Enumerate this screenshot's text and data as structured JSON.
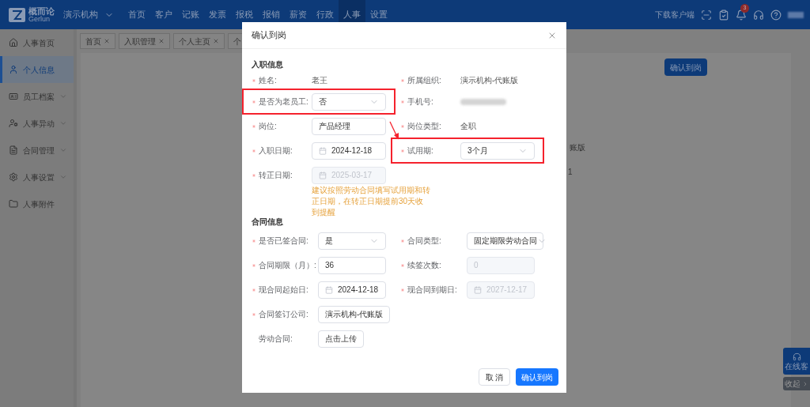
{
  "nav": {
    "logo_name": "概而论",
    "logo_sub": "Gerlun",
    "org": "演示机构",
    "menu": [
      {
        "label": "首页",
        "selected": false
      },
      {
        "label": "客户",
        "selected": false
      },
      {
        "label": "记账",
        "selected": false
      },
      {
        "label": "发票",
        "selected": false
      },
      {
        "label": "报税",
        "selected": false
      },
      {
        "label": "报销",
        "selected": false
      },
      {
        "label": "薪资",
        "selected": false
      },
      {
        "label": "行政",
        "selected": false
      },
      {
        "label": "人事",
        "selected": true
      },
      {
        "label": "设置",
        "selected": false
      }
    ],
    "download": "下载客户端",
    "badge": "3"
  },
  "sidebar": {
    "items": [
      {
        "label": "人事首页",
        "selected": false,
        "expandable": false
      },
      {
        "label": "个人信息",
        "selected": true,
        "expandable": false
      },
      {
        "label": "员工档案",
        "selected": false,
        "expandable": true
      },
      {
        "label": "人事异动",
        "selected": false,
        "expandable": true
      },
      {
        "label": "合同管理",
        "selected": false,
        "expandable": true
      },
      {
        "label": "人事设置",
        "selected": false,
        "expandable": true
      },
      {
        "label": "人事附件",
        "selected": false,
        "expandable": false
      }
    ]
  },
  "tabs": [
    {
      "label": "首页",
      "closable": true
    },
    {
      "label": "入职管理",
      "closable": true
    },
    {
      "label": "个人主页",
      "closable": true
    },
    {
      "label": "个",
      "closable": false
    }
  ],
  "content": {
    "confirm_button": "确认到岗",
    "fragments": [
      "账版",
      "1"
    ]
  },
  "floating": {
    "service": "在线客",
    "collapse": "收起"
  },
  "modal": {
    "title": "确认到岗",
    "sections": [
      {
        "title": "入职信息",
        "rows": [
          {
            "fields": [
              {
                "label": "姓名:",
                "required": true,
                "kind": "text",
                "value": "老王",
                "highlighted": false
              },
              {
                "label": "所属组织:",
                "required": true,
                "kind": "text",
                "value": "演示机构-代账版",
                "highlighted": false
              }
            ]
          },
          {
            "fields": [
              {
                "label": "是否为老员工:",
                "required": true,
                "kind": "select",
                "value": "否",
                "highlighted": true
              },
              {
                "label": "手机号:",
                "required": true,
                "kind": "blurred",
                "highlighted": false
              }
            ]
          },
          {
            "fields": [
              {
                "label": "岗位:",
                "required": true,
                "kind": "input",
                "value": "产品经理",
                "disabled": false,
                "highlighted": false
              },
              {
                "label": "岗位类型:",
                "required": true,
                "kind": "text",
                "value": "全职",
                "highlighted": false
              }
            ]
          },
          {
            "fields": [
              {
                "label": "入职日期:",
                "required": true,
                "kind": "date",
                "value": "2024-12-18",
                "disabled": false,
                "highlighted": false
              },
              {
                "label": "试用期:",
                "required": true,
                "kind": "select",
                "value": "3个月",
                "highlighted": true
              }
            ]
          },
          {
            "fields": [
              {
                "label": "转正日期:",
                "required": true,
                "kind": "date",
                "value": "2025-03-17",
                "disabled": true,
                "highlighted": false,
                "hint": "建议按照劳动合同填写试用期和转正日期，在转正日期提前30天收到提醒"
              }
            ]
          }
        ]
      },
      {
        "title": "合同信息",
        "rows": [
          {
            "fields": [
              {
                "label": "是否已签合同:",
                "required": true,
                "kind": "select",
                "value": "是",
                "highlighted": false
              },
              {
                "label": "合同类型:",
                "required": true,
                "kind": "select",
                "value": "固定期限劳动合同",
                "highlighted": false
              }
            ]
          },
          {
            "fields": [
              {
                "label": "合同期限（月）:",
                "required": true,
                "kind": "input",
                "value": "36",
                "disabled": false,
                "highlighted": false
              },
              {
                "label": "续签次数:",
                "required": true,
                "kind": "input",
                "value": "0",
                "disabled": true,
                "highlighted": false
              }
            ]
          },
          {
            "fields": [
              {
                "label": "现合同起始日:",
                "required": true,
                "kind": "date",
                "value": "2024-12-18",
                "disabled": false,
                "highlighted": false
              },
              {
                "label": "现合同到期日:",
                "required": true,
                "kind": "date",
                "value": "2027-12-17",
                "disabled": true,
                "highlighted": false
              }
            ]
          },
          {
            "fields": [
              {
                "label": "合同签订公司:",
                "required": true,
                "kind": "input",
                "value": "演示机构-代账版",
                "disabled": false,
                "highlighted": false
              }
            ]
          },
          {
            "fields": [
              {
                "label": "劳动合同:",
                "required": false,
                "kind": "upload",
                "value": "点击上传",
                "highlighted": false
              }
            ]
          }
        ]
      }
    ],
    "cancel": "取 消",
    "confirm": "确认到岗"
  }
}
